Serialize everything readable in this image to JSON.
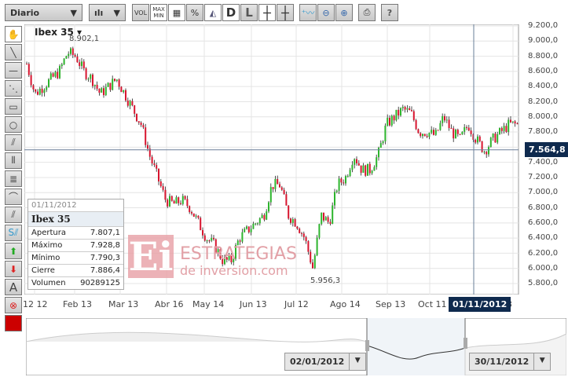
{
  "toolbar": {
    "period": "Diario",
    "chart_type": "candles",
    "buttons": [
      "VOL",
      "MAX MIN",
      "grid",
      "%",
      "area",
      "D",
      "L",
      "crosshair",
      "crosshair-L",
      "add-indicator",
      "zoom-out",
      "zoom-in",
      "print",
      "?"
    ]
  },
  "legend": {
    "symbol": "Ibex 35",
    "max_label": "8.902,1",
    "min_label": "5.956,3"
  },
  "info_box": {
    "date": "01/11/2012",
    "name": "Ibex 35",
    "rows": [
      {
        "k": "Apertura",
        "v": "7.807,1"
      },
      {
        "k": "Máximo",
        "v": "7.928,8"
      },
      {
        "k": "Mínimo",
        "v": "7.790,3"
      },
      {
        "k": "Cierre",
        "v": "7.886,4"
      },
      {
        "k": "Volumen",
        "v": "90289125"
      }
    ]
  },
  "crosshair": {
    "date": "01/11/2012",
    "price": "7.564,8"
  },
  "watermark": {
    "line1": "ESTRATEGIAS",
    "line2": "de inversion.com",
    "logo": "Ei"
  },
  "navigator": {
    "from": "02/01/2012",
    "to": "30/11/2012"
  },
  "colors": {
    "up": "#2db52d",
    "down": "#d8152f",
    "tip": "#0f2a4e"
  },
  "chart_data": {
    "type": "candlestick",
    "title": "Ibex 35",
    "ylim": [
      5800,
      9200
    ],
    "yticks": [
      "9.200,0",
      "9.000,0",
      "8.800,0",
      "8.600,0",
      "8.400,0",
      "8.200,0",
      "8.000,0",
      "7.800,0",
      "7.600,0",
      "7.400,0",
      "7.200,0",
      "7.000,0",
      "6.800,0",
      "6.600,0",
      "6.400,0",
      "6.200,0",
      "6.000,0",
      "5.800,0"
    ],
    "xticks": [
      "12 12",
      "Feb 13",
      "Mar 13",
      "Abr 16",
      "May 14",
      "Jun 13",
      "Jul 12",
      "Ago 14",
      "Sep 13",
      "Oct 11",
      "23"
    ],
    "closes": [
      8700,
      8300,
      8400,
      8500,
      8600,
      8850,
      8800,
      8600,
      8500,
      8300,
      8400,
      8500,
      8300,
      8100,
      7900,
      7500,
      7200,
      6900,
      6850,
      6900,
      6800,
      6600,
      6400,
      6300,
      6100,
      6100,
      6400,
      6500,
      6600,
      6700,
      7100,
      7100,
      6700,
      6600,
      6400,
      6000,
      6700,
      6600,
      7100,
      7200,
      7500,
      7300,
      7300,
      7500,
      7900,
      8000,
      8100,
      8050,
      7800,
      7800,
      7750,
      8000,
      7800,
      7700,
      7900,
      7700,
      7550,
      7700,
      7800,
      7900,
      7900
    ]
  }
}
